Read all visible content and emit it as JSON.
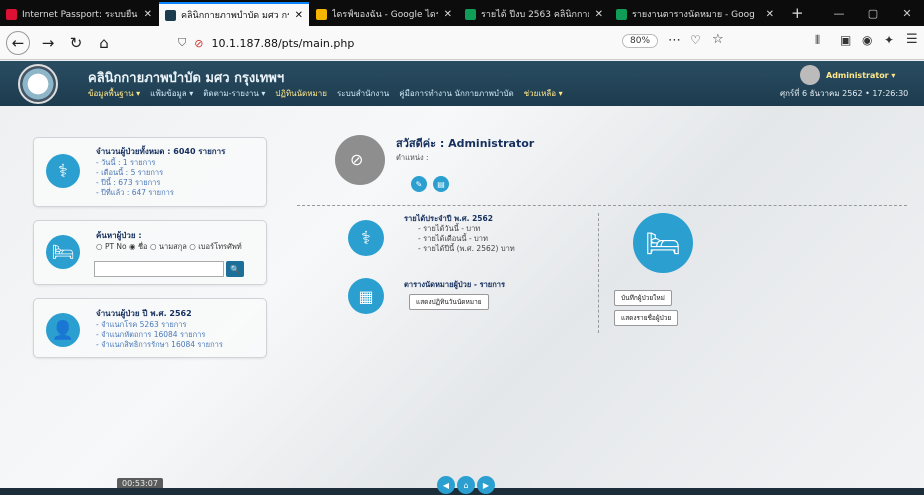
{
  "browser": {
    "tabs": [
      {
        "title": "Internet Passport: ระบบยืนยัน",
        "fav": "#d13",
        "active": false
      },
      {
        "title": "คลินิกกายภาพบำบัด มศว กรุงเทพฯ",
        "fav": "#1d3b4f",
        "active": true
      },
      {
        "title": "ไดรฟ์ของฉัน - Google ไดรฟ์",
        "fav": "#f4b400",
        "active": false
      },
      {
        "title": "รายได้ ปีงบ 2563 คลินิกกายภ",
        "fav": "#0f9d58",
        "active": false
      },
      {
        "title": "รายงานตารางนัดหมาย - Goog",
        "fav": "#0f9d58",
        "active": false
      }
    ],
    "new_tab": "+",
    "url": "10.1.187.88/pts/main.php",
    "zoom": "80%"
  },
  "header": {
    "title": "คลินิกกายภาพบำบัด มศว กรุงเทพฯ",
    "menu": [
      "ข้อมูลพื้นฐาน ▾",
      "แฟ้มข้อมูล ▾",
      "ติดตาม-รายงาน ▾",
      "ปฏิทินนัดหมาย",
      "ระบบสำนักงาน",
      "คู่มือการทำงาน นักกายภาพบำบัด",
      "ช่วยเหลือ ▾"
    ],
    "user": "Administrator ▾",
    "datetime": "ศุกร์ที่ 6 ธันวาคม 2562 • 17:26:30"
  },
  "card_total": {
    "title": "จำนวนผู้ป่วยทั้งหมด : 6040 รายการ",
    "lines": [
      "- วันนี้ : 1 รายการ",
      "- เดือนนี้ : 5 รายการ",
      "- ปีนี้ : 673 รายการ",
      "- ปีที่แล้ว : 647 รายการ"
    ]
  },
  "card_search": {
    "title": "ค้นหาผู้ป่วย :",
    "options": [
      "PT No",
      "ชื่อ",
      "นามสกุล",
      "เบอร์โทรศัพท์"
    ]
  },
  "card_year": {
    "title": "จำนวนผู้ป่วย ปี พ.ศ. 2562",
    "lines": [
      "- จำแนกโรค 5263 รายการ",
      "- จำแนกหัตถการ 16084 รายการ",
      "- จำแนกสิทธิการรักษา 16084 รายการ"
    ]
  },
  "profile": {
    "greeting": "สวัสดีค่ะ : Administrator",
    "position": "ตำแหน่ง :"
  },
  "income": {
    "title": "รายได้ประจำปี พ.ศ. 2562",
    "lines": [
      "- รายได้วันนี้ - บาท",
      "- รายได้เดือนนี้ - บาท",
      "- รายได้ปีนี้ (พ.ศ. 2562) บาท"
    ]
  },
  "appointment": {
    "title": "ตารางนัดหมายผู้ป่วย - รายการ",
    "button": "แสดงปฏิทินวันนัดหมาย"
  },
  "patient_actions": {
    "new_button": "บันทึกผู้ป่วยใหม่",
    "list_button": "แสดงรายชื่อผู้ป่วย"
  },
  "timer": "00:53:07",
  "colors": {
    "accent": "#2a9fd0",
    "header": "#1d3b4f"
  }
}
